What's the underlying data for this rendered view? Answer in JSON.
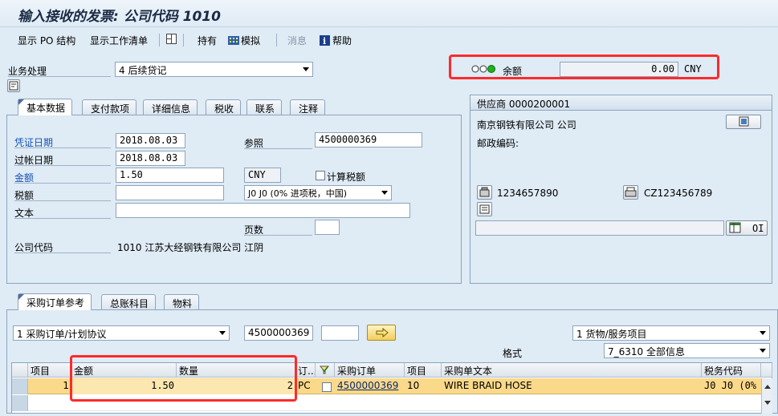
{
  "title": "输入接收的发票: 公司代码 1010",
  "toolbar": {
    "show_po_structure": "显示 PO 结构",
    "show_worklist": "显示工作清单",
    "hold": "持有",
    "simulate": "模拟",
    "messages": "消息",
    "help": "帮助"
  },
  "transaction": {
    "label": "业务处理",
    "value": "4 后续贷记"
  },
  "balance": {
    "label": "余额",
    "value": "0.00",
    "currency": "CNY"
  },
  "tabs_top": [
    "基本数据",
    "支付款项",
    "详细信息",
    "税收",
    "联系",
    "注释"
  ],
  "basic": {
    "doc_date_label": "凭证日期",
    "doc_date": "2018.08.03",
    "post_date_label": "过帐日期",
    "post_date": "2018.08.03",
    "amount_label": "金额",
    "amount": "1.50",
    "currency": "CNY",
    "tax_label": "税额",
    "tax": "",
    "tax_code": "J0 J0 (0% 进项税，中国)",
    "calc_tax_label": "计算税额",
    "text_label": "文本",
    "text": "",
    "ref_label": "参照",
    "ref": "4500000369",
    "pages_label": "页数",
    "pages": "",
    "company_label": "公司代码",
    "company": "1010 江苏大经钢铁有限公司 江阴"
  },
  "vendor": {
    "header": "供应商 0000200001",
    "name": "南京钢铁有限公司 公司",
    "postcode_label": "邮政编码:",
    "phone": "1234657890",
    "fax": "CZ123456789",
    "oi_label": "OI"
  },
  "tabs_bottom": [
    "采购订单参考",
    "总账科目",
    "物料"
  ],
  "po_ref": {
    "type": "1 采购订单/计划协议",
    "po_number": "4500000369",
    "item": "",
    "goods_type": "1 货物/服务项目",
    "layout_label": "格式",
    "layout": "7_6310 全部信息"
  },
  "grid": {
    "headers": [
      "项目",
      "金额",
      "数量",
      "订...",
      "",
      "采购订单",
      "项目",
      "采购单文本",
      "税务代码"
    ],
    "rows": [
      {
        "item": "1",
        "amount": "1.50",
        "qty": "2",
        "unit": "PC",
        "po": "4500000369",
        "po_item": "10",
        "text": "WIRE BRAID HOSE",
        "tax": "J0 J0 (0%"
      }
    ]
  },
  "colors": {
    "highlight": "#ff2a2a",
    "row_selected": "#fbd98a",
    "accent": "#1552b8"
  }
}
